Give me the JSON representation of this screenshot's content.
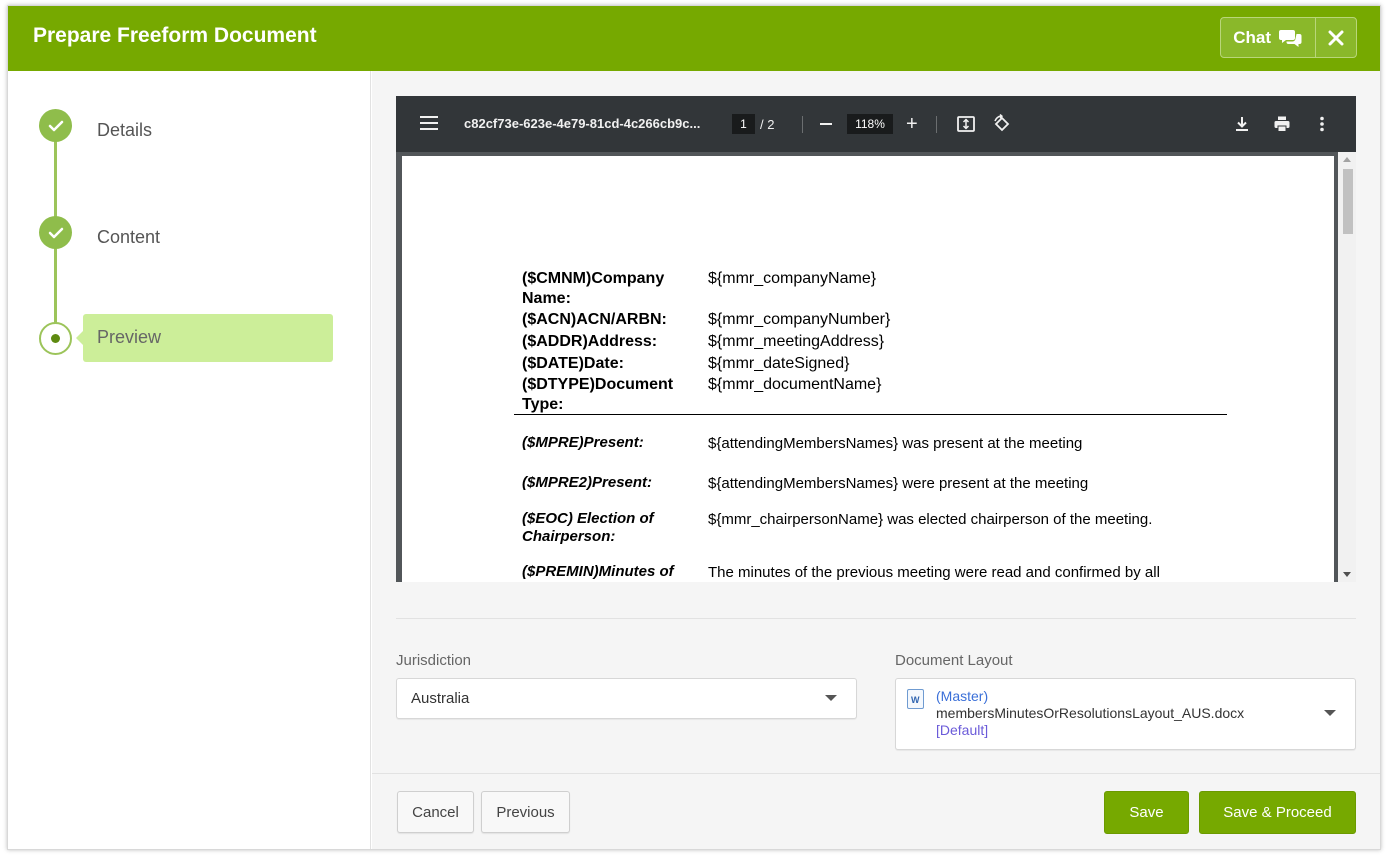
{
  "header": {
    "title": "Prepare Freeform Document",
    "chat_label": "Chat"
  },
  "steps": [
    {
      "label": "Details",
      "status": "complete"
    },
    {
      "label": "Content",
      "status": "complete"
    },
    {
      "label": "Preview",
      "status": "current"
    }
  ],
  "viewer": {
    "filename": "c82cf73e-623e-4e79-81cd-4c266cb9c...",
    "current_page": "1",
    "page_total": "/  2",
    "zoom": "118%"
  },
  "document": {
    "fields": [
      {
        "label": "($CMNM)Company Name:",
        "value": "${mmr_companyName}"
      },
      {
        "label": "($ACN)ACN/ARBN:",
        "value": "${mmr_companyNumber}"
      },
      {
        "label": "($ADDR)Address:",
        "value": "${mmr_meetingAddress}"
      },
      {
        "label": "($DATE)Date:",
        "value": "${mmr_dateSigned}"
      },
      {
        "label": "($DTYPE)Document Type:",
        "value": "${mmr_documentName}"
      }
    ],
    "items": [
      {
        "label": "($MPRE)Present:",
        "value": "${attendingMembersNames} was present at the meeting"
      },
      {
        "label": "($MPRE2)Present:",
        "value": "${attendingMembersNames} were present at the meeting"
      },
      {
        "label": "($EOC) Election of Chairperson:",
        "value": "${mmr_chairpersonName} was elected chairperson of the meeting."
      },
      {
        "label": "($PREMIN)Minutes of",
        "value": "The minutes of the previous meeting were read and confirmed by all"
      }
    ]
  },
  "jurisdiction": {
    "label": "Jurisdiction",
    "value": "Australia"
  },
  "document_layout": {
    "label": "Document Layout",
    "icon_letter": "W",
    "master": "(Master)",
    "name": "membersMinutesOrResolutionsLayout_AUS.docx",
    "default": "[Default]"
  },
  "footer": {
    "cancel": "Cancel",
    "previous": "Previous",
    "save": "Save",
    "save_proceed": "Save & Proceed"
  },
  "colors": {
    "brand_green": "#76a900",
    "step_green": "#8fbd4b",
    "active_step_bg": "#ccee99",
    "viewer_toolbar": "#323639"
  }
}
